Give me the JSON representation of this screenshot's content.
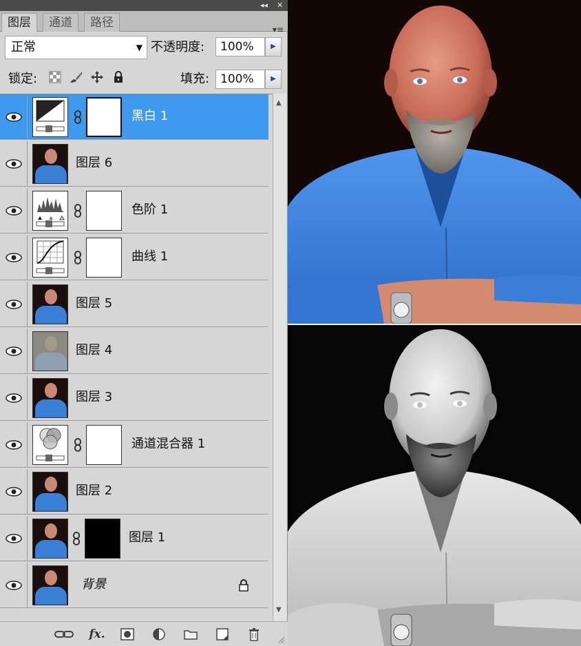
{
  "window": {
    "collapse_glyph": "◂◂",
    "close_glyph": "✕",
    "menu_glyph": "▾≡"
  },
  "tabs": [
    {
      "label": "图层",
      "active": true
    },
    {
      "label": "通道",
      "active": false
    },
    {
      "label": "路径",
      "active": false
    }
  ],
  "blend": {
    "value": "正常"
  },
  "opacity": {
    "label": "不透明度:",
    "value": "100%"
  },
  "lock": {
    "label": "锁定:",
    "icons": [
      "transparent-pixels-lock-icon",
      "brush-lock-icon",
      "move-lock-icon",
      "padlock-icon"
    ]
  },
  "fill": {
    "label": "填充:",
    "value": "100%"
  },
  "layers": [
    {
      "name": "黑白 1",
      "type": "adjustment-bw",
      "mask": "white",
      "selected": true
    },
    {
      "name": "图层 6",
      "type": "photo"
    },
    {
      "name": "色阶 1",
      "type": "adjustment-levels",
      "mask": "white"
    },
    {
      "name": "曲线 1",
      "type": "adjustment-curves",
      "mask": "white"
    },
    {
      "name": "图层 5",
      "type": "photo"
    },
    {
      "name": "图层 4",
      "type": "photo-gray"
    },
    {
      "name": "图层 3",
      "type": "photo"
    },
    {
      "name": "通道混合器 1",
      "type": "adjustment-mixer",
      "mask": "white"
    },
    {
      "name": "图层 2",
      "type": "photo"
    },
    {
      "name": "图层 1",
      "type": "photo",
      "mask": "black"
    },
    {
      "name": "背景",
      "type": "photo",
      "locked": true
    }
  ],
  "bottom_icons": [
    "link-layers-icon",
    "fx-icon",
    "add-mask-icon",
    "adjustment-layer-icon",
    "new-group-icon",
    "new-layer-icon",
    "trash-icon"
  ],
  "colors": {
    "panel_bg": "#d6d6d6",
    "selected_row": "#3d9aee",
    "shirt_blue": "#3a7fd6"
  }
}
